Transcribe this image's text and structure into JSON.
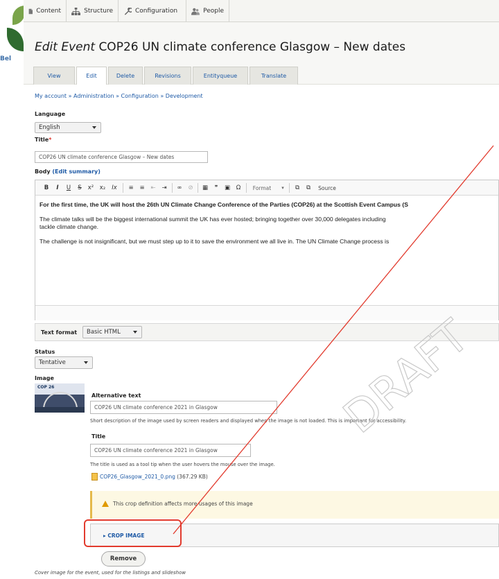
{
  "toolbar": {
    "items": [
      {
        "label": "Content",
        "icon": "document-icon"
      },
      {
        "label": "Structure",
        "icon": "sitemap-icon"
      },
      {
        "label": "Configuration",
        "icon": "wrench-icon"
      },
      {
        "label": "People",
        "icon": "people-icon"
      }
    ]
  },
  "brand": {
    "text": "Bel"
  },
  "header": {
    "title_prefix": "Edit Event",
    "title": "COP26 UN climate conference Glasgow – New dates",
    "tabs": [
      "View",
      "Edit",
      "Delete",
      "Revisions",
      "Entityqueue",
      "Translate"
    ],
    "active_tab": "Edit"
  },
  "breadcrumb": "My account » Administration » Configuration » Development",
  "form": {
    "language": {
      "label": "Language",
      "value": "English"
    },
    "title": {
      "label": "Title",
      "required_mark": "*",
      "value": "COP26 UN climate conference Glasgow – New dates"
    },
    "body": {
      "label": "Body",
      "edit_summary_open": "(",
      "edit_summary": "Edit summary",
      "edit_summary_close": ")",
      "toolbar": [
        "B",
        "I",
        "U",
        "S",
        "x²",
        "x₂",
        "Ix",
        "≡",
        "≡",
        "⇤",
        "⇥",
        "∞",
        "⊘",
        "▦",
        "❞",
        "▣",
        "Ω",
        "Format",
        "▾",
        "⧉",
        "⧉",
        "Source"
      ],
      "paragraphs": [
        "For the first time, the UK will host the 26th UN Climate Change Conference of the Parties (COP26) at the Scottish Event Campus (S",
        "The climate talks will be the biggest international summit the UK has ever hosted; bringing together over 30,000 delegates including",
        "tackle climate change.",
        "The challenge is not insignificant, but we must step up to it to save the environment we all live in. The UN Climate Change process is"
      ]
    },
    "text_format": {
      "label": "Text format",
      "value": "Basic HTML"
    },
    "status": {
      "label": "Status",
      "value": "Tentative"
    },
    "image": {
      "label": "Image",
      "thumb_text": "COP 26",
      "alt_label": "Alternative text",
      "alt_value": "COP26 UN climate conference 2021 in Glasgow",
      "alt_desc": "Short description of the image used by screen readers and displayed when the image is not loaded. This is important for accessibility.",
      "title_label": "Title",
      "title_value": "COP26 UN climate conference 2021 in Glasgow",
      "title_desc": "The title is used as a tool tip when the user hovers the mouse over the image.",
      "file_name": "COP26_Glasgow_2021_0.png",
      "file_size": "(367.29 KB)",
      "warning": "This crop definition affects more usages of this image",
      "crop_label": "CROP IMAGE",
      "remove_label": "Remove"
    },
    "cover_note": "Cover image for the event, used for the listings and slideshow"
  },
  "watermark": "DRAFT",
  "colors": {
    "accent": "#1e5aa6",
    "highlight": "#e23b2e",
    "warning": "#e09a00"
  }
}
